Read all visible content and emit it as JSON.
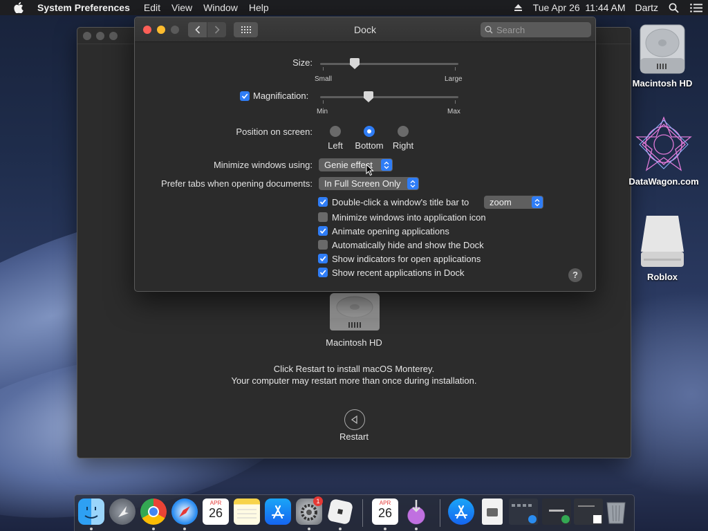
{
  "menubar": {
    "app_name": "System Preferences",
    "items": [
      "Edit",
      "View",
      "Window",
      "Help"
    ],
    "datetime": "Tue Apr 26  11:44 AM",
    "user": "Dartz"
  },
  "installer": {
    "disk_label": "Macintosh HD",
    "message_line1": "Click Restart to install macOS Monterey.",
    "message_line2": "Your computer may restart more than once during installation.",
    "restart_label": "Restart"
  },
  "dock_prefs": {
    "title": "Dock",
    "search_placeholder": "Search",
    "size": {
      "label": "Size:",
      "min_label": "Small",
      "max_label": "Large",
      "value": 0.25
    },
    "magnification": {
      "label": "Magnification:",
      "checked": true,
      "min_label": "Min",
      "max_label": "Max",
      "value": 0.35
    },
    "position": {
      "label": "Position on screen:",
      "options": [
        "Left",
        "Bottom",
        "Right"
      ],
      "selected": "Bottom"
    },
    "minimize": {
      "label": "Minimize windows using:",
      "value": "Genie effect"
    },
    "prefer_tabs": {
      "label": "Prefer tabs when opening documents:",
      "value": "In Full Screen Only"
    },
    "double_click": {
      "label": "Double-click a window's title bar to",
      "value": "zoom"
    },
    "checkboxes": [
      {
        "label": "Minimize windows into application icon",
        "checked": false
      },
      {
        "label": "Animate opening applications",
        "checked": true
      },
      {
        "label": "Automatically hide and show the Dock",
        "checked": false
      },
      {
        "label": "Show indicators for open applications",
        "checked": true
      },
      {
        "label": "Show recent applications in Dock",
        "checked": true
      }
    ],
    "help": "?"
  },
  "desktop": {
    "icons": [
      "Macintosh HD",
      "DataWagon.com",
      "Roblox"
    ]
  },
  "dock": {
    "badge_count": "1",
    "calendar_month": "APR",
    "calendar_day": "26",
    "apps": [
      "Finder",
      "Launchpad",
      "Google Chrome",
      "Safari",
      "Calendar",
      "Notes",
      "App Store",
      "System Preferences",
      "Roblox",
      "Calendar",
      "Installer",
      "App Store",
      "Preview",
      "Mission Control",
      "Google Chrome Window",
      "Calendar Window",
      "Trash"
    ]
  },
  "colors": {
    "accent": "#2f7df6",
    "close": "#fe5f57",
    "minimize": "#febc2e"
  }
}
